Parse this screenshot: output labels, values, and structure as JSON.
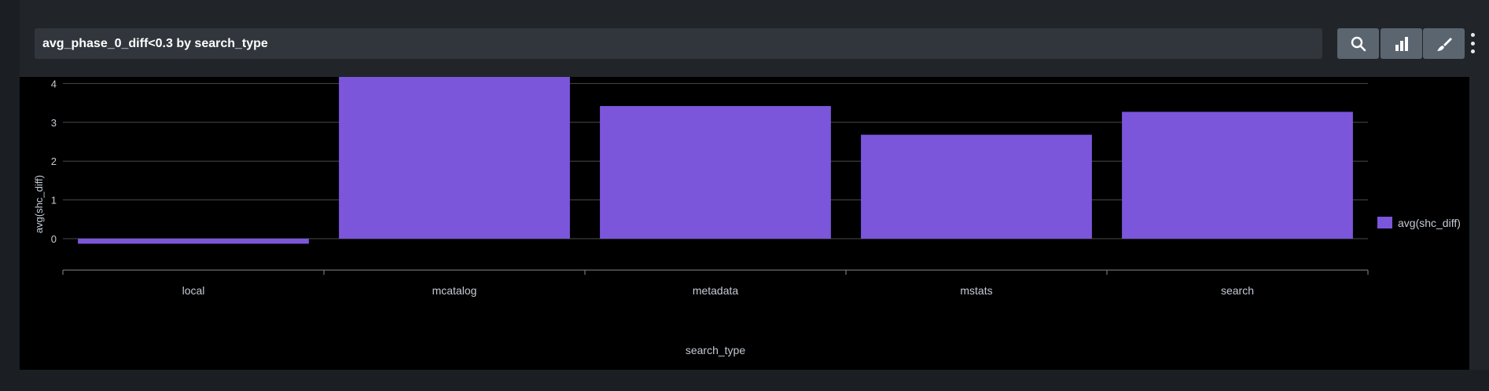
{
  "search": {
    "query": "avg_phase_0_diff<0.3 by search_type"
  },
  "toolbar": {
    "search_icon": "search-icon",
    "visualization_icon": "bar-chart-icon",
    "format_icon": "paintbrush-icon",
    "more_icon": "vertical-ellipsis-icon"
  },
  "colors": {
    "series": "#7b56db",
    "background": "#000000",
    "panel": "#212529",
    "gridline": "#4a4a4a",
    "text": "#c3cbd4"
  },
  "chart_data": {
    "type": "bar",
    "categories": [
      "local",
      "mcatalog",
      "metadata",
      "mstats",
      "search"
    ],
    "series": [
      {
        "name": "avg(shc_diff)",
        "values": [
          -0.13,
          4.28,
          3.42,
          2.68,
          3.27
        ]
      }
    ],
    "xlabel": "search_type",
    "ylabel": "avg(shc_diff)",
    "ylim": [
      -1,
      5
    ],
    "yticks": [
      0,
      1,
      2,
      3,
      4,
      5
    ],
    "grid": true,
    "legend": "right"
  }
}
